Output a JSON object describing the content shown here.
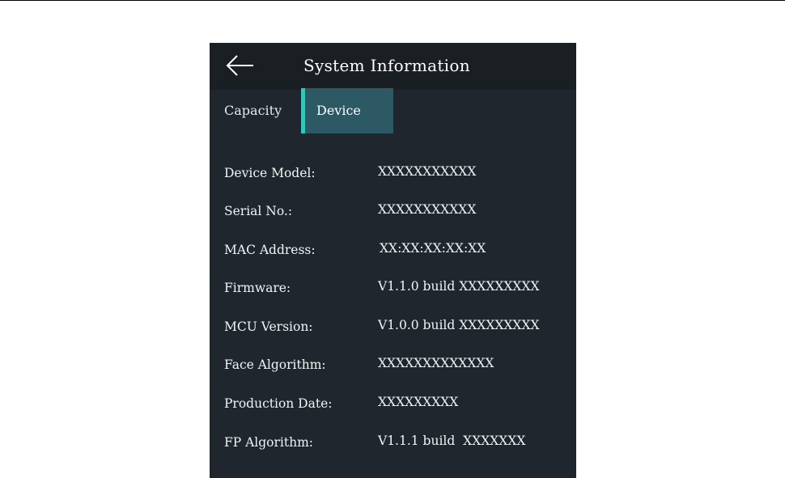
{
  "header": {
    "title": "System Information",
    "back_icon": "arrow-left-icon"
  },
  "tabs": [
    {
      "label": "Capacity",
      "active": false
    },
    {
      "label": "Device",
      "active": true
    }
  ],
  "colors": {
    "screen_background": "#1f262d",
    "title_bar_background": "#1a1f24",
    "active_tab_background": "#2c5964",
    "active_tab_indicator": "#36c6b8",
    "text": "#ffffff"
  },
  "device_info": [
    {
      "label": "Device Model:",
      "value": "XXXXXXXXXXX"
    },
    {
      "label": "Serial No.:",
      "value": "XXXXXXXXXXX"
    },
    {
      "label": "MAC Address:",
      "value": "XX:XX:XX:XX:XX"
    },
    {
      "label": "Firmware:",
      "value": "V1.1.0 build XXXXXXXXX"
    },
    {
      "label": "MCU Version:",
      "value": "V1.0.0 build XXXXXXXXX"
    },
    {
      "label": "Face Algorithm:",
      "value": "XXXXXXXXXXXXX"
    },
    {
      "label": "Production Date:",
      "value": "XXXXXXXXX"
    },
    {
      "label": "FP Algorithm:",
      "value": "V1.1.1 build  XXXXXXX"
    }
  ]
}
